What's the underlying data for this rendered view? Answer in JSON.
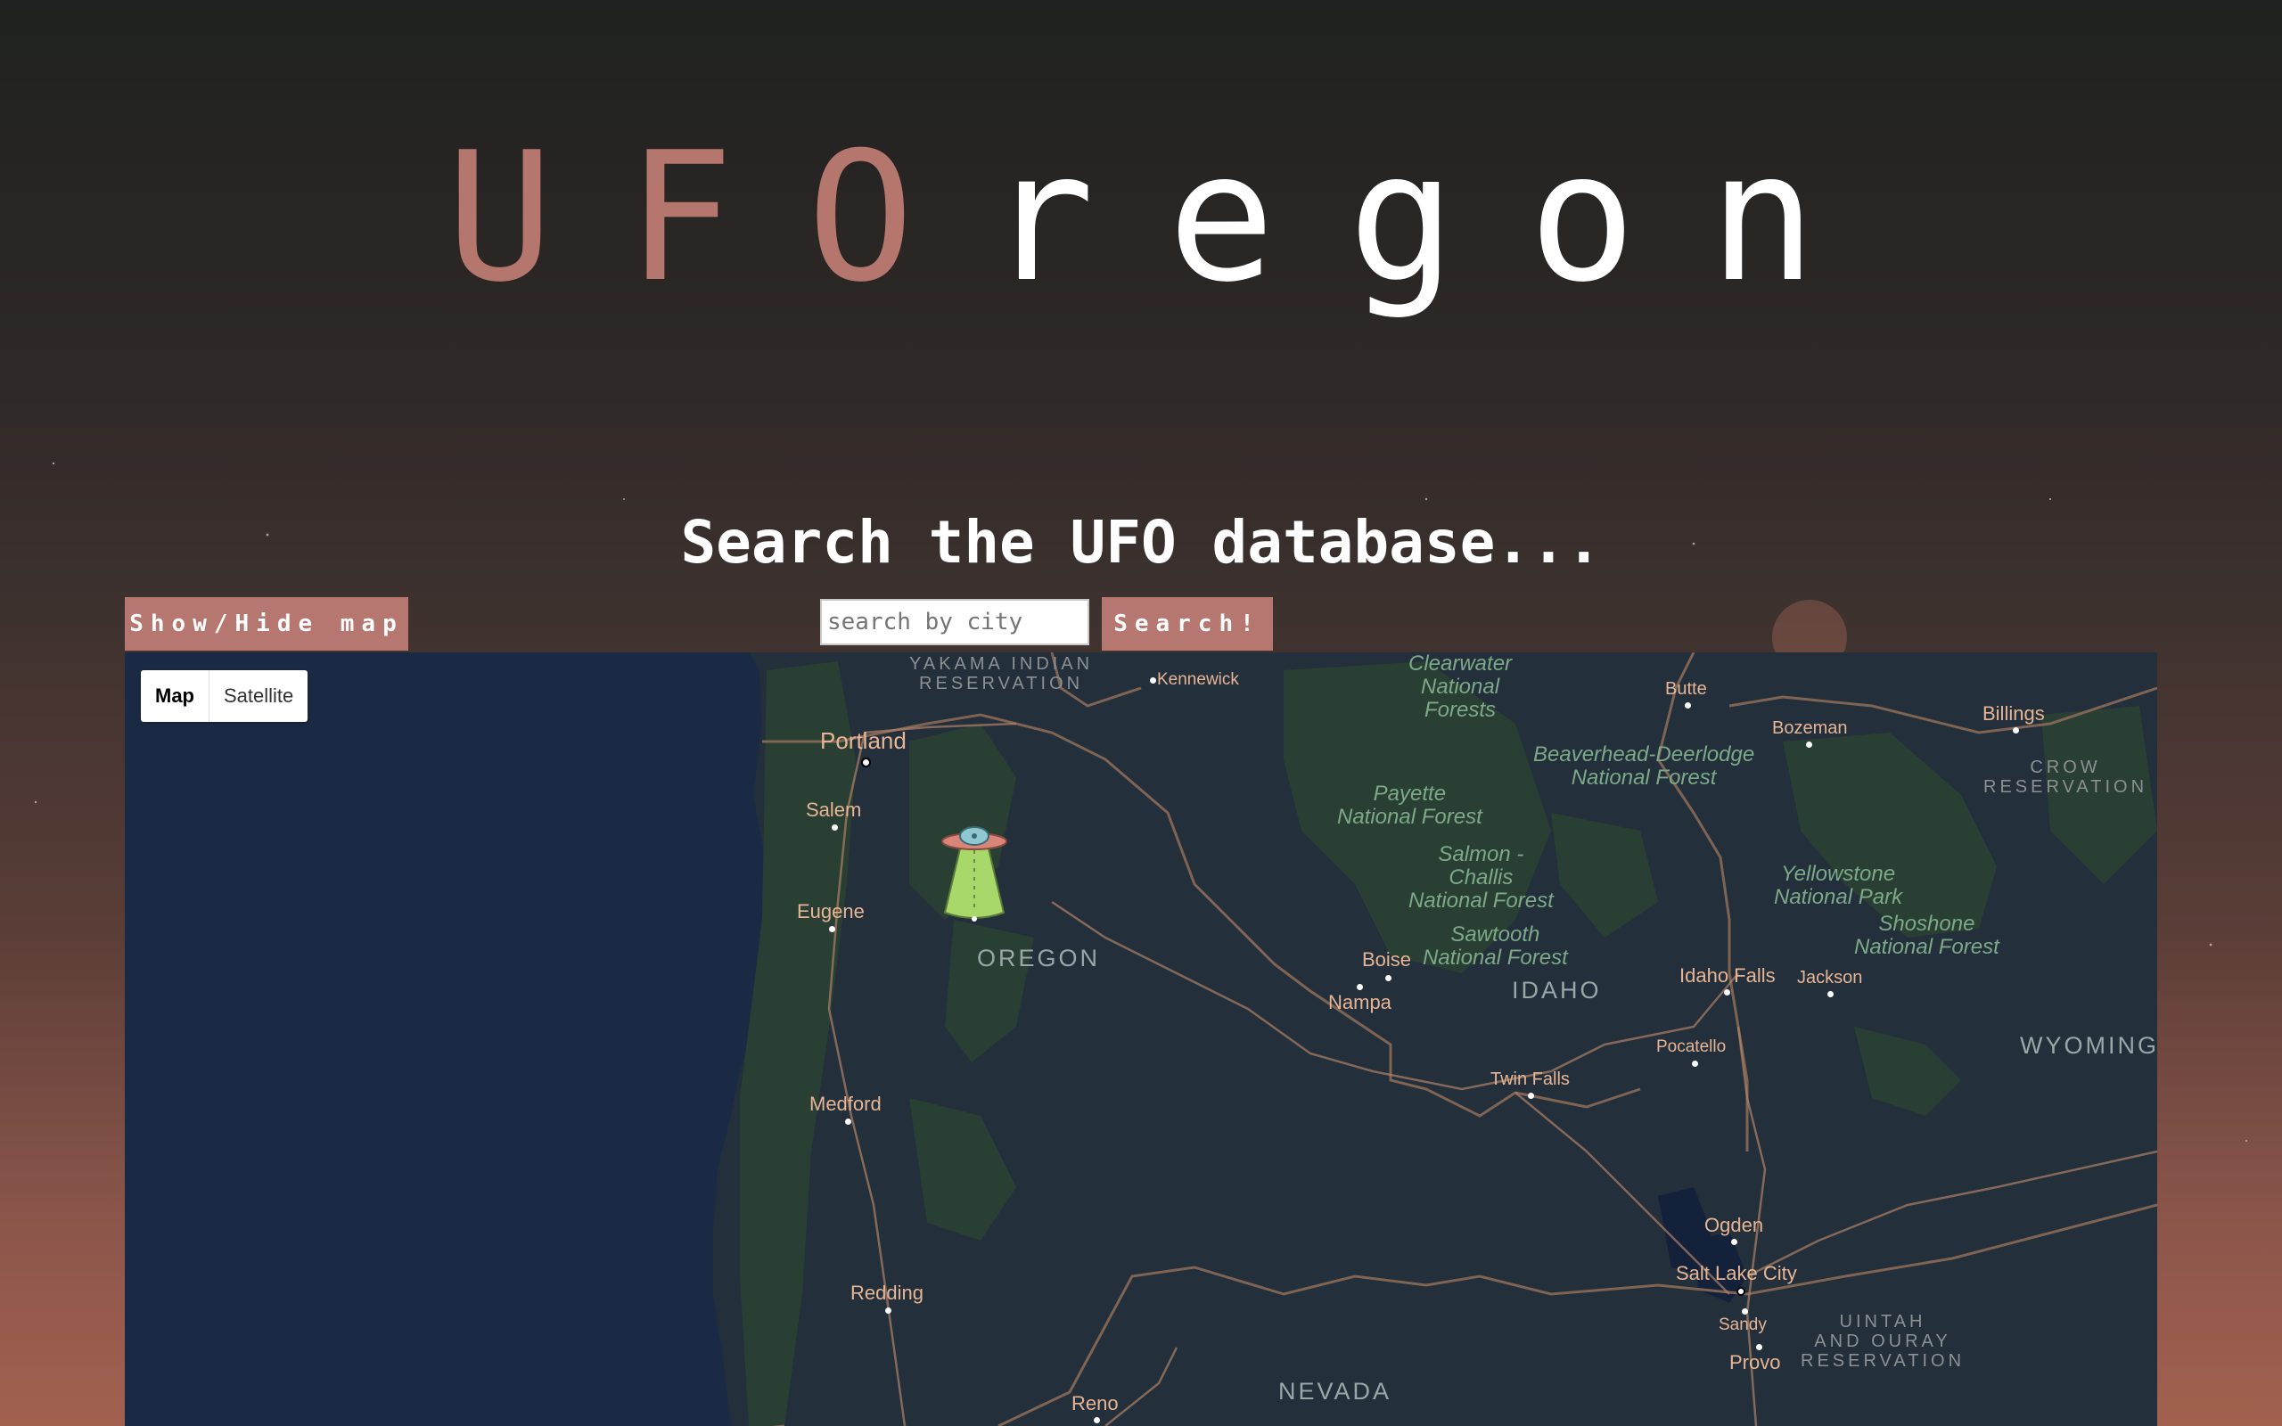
{
  "logo": {
    "accent": "UFO",
    "rest": "regon"
  },
  "subtitle": "Search the UFO database...",
  "controls": {
    "toggle_map_label": "Show/Hide map",
    "search_placeholder": "search by city",
    "search_button_label": "Search!"
  },
  "colors": {
    "accent": "#b5776f",
    "map_water": "#1b2a44",
    "map_land": "#232f3a"
  },
  "map": {
    "map_type": {
      "map_label": "Map",
      "satellite_label": "Satellite",
      "selected": "Map"
    },
    "marker_icon": "ufo-icon",
    "cities": {
      "portland": "Portland",
      "salem": "Salem",
      "eugene": "Eugene",
      "medford": "Medford",
      "redding": "Redding",
      "reno": "Reno",
      "kennewick": "Kennewick",
      "boise": "Boise",
      "nampa": "Nampa",
      "twin_falls": "Twin Falls",
      "pocatello": "Pocatello",
      "idaho_falls": "Idaho Falls",
      "jackson": "Jackson",
      "butte": "Butte",
      "bozeman": "Bozeman",
      "billings": "Billings",
      "ogden": "Ogden",
      "salt_lake_city": "Salt Lake City",
      "sandy": "Sandy",
      "provo": "Provo"
    },
    "regions": {
      "oregon": "OREGON",
      "idaho": "IDAHO",
      "nevada": "NEVADA",
      "wyoming": "WYOMING"
    },
    "forests": {
      "clearwater": [
        "Clearwater",
        "National",
        "Forests"
      ],
      "beaverhead": [
        "Beaverhead-Deerlodge",
        "National Forest"
      ],
      "payette": [
        "Payette",
        "National Forest"
      ],
      "salmon": [
        "Salmon -",
        "Challis",
        "National Forest"
      ],
      "sawtooth": [
        "Sawtooth",
        "National Forest"
      ],
      "yellowstone": [
        "Yellowstone",
        "National Park"
      ],
      "shoshone": [
        "Shoshone",
        "National Forest"
      ]
    },
    "reservations": {
      "yakama": [
        "YAKAMA INDIAN",
        "RESERVATION"
      ],
      "crow": [
        "CROW",
        "RESERVATION"
      ],
      "uintah": [
        "UINTAH",
        "AND OURAY",
        "RESERVATION"
      ]
    }
  }
}
